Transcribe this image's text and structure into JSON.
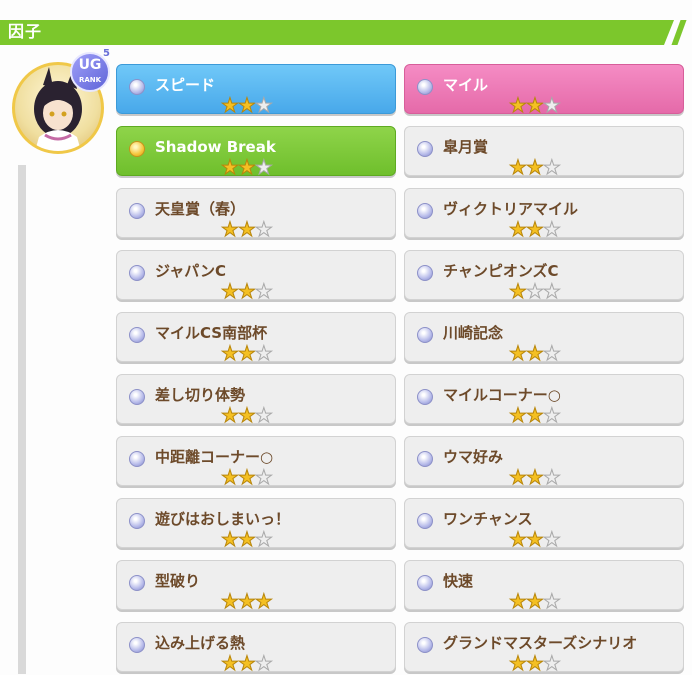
{
  "section": {
    "title": "因子"
  },
  "avatar": {
    "rank_text": "UG",
    "rank_sub": "RANK",
    "rank_level": "5"
  },
  "factors": [
    {
      "label": "スピード",
      "stars": 2,
      "style": "blue"
    },
    {
      "label": "マイル",
      "stars": 2,
      "style": "pink"
    },
    {
      "label": "Shadow Break",
      "stars": 2,
      "style": "green"
    },
    {
      "label": "皐月賞",
      "stars": 2,
      "style": "normal"
    },
    {
      "label": "天皇賞（春）",
      "stars": 2,
      "style": "normal"
    },
    {
      "label": "ヴィクトリアマイル",
      "stars": 2,
      "style": "normal"
    },
    {
      "label": "ジャパンC",
      "stars": 2,
      "style": "normal"
    },
    {
      "label": "チャンピオンズC",
      "stars": 1,
      "style": "normal"
    },
    {
      "label": "マイルCS南部杯",
      "stars": 2,
      "style": "normal"
    },
    {
      "label": "川崎記念",
      "stars": 2,
      "style": "normal"
    },
    {
      "label": "差し切り体勢",
      "stars": 2,
      "style": "normal"
    },
    {
      "label": "マイルコーナー○",
      "stars": 2,
      "style": "normal"
    },
    {
      "label": "中距離コーナー○",
      "stars": 2,
      "style": "normal"
    },
    {
      "label": "ウマ好み",
      "stars": 2,
      "style": "normal"
    },
    {
      "label": "遊びはおしまいっ！",
      "stars": 2,
      "style": "normal"
    },
    {
      "label": "ワンチャンス",
      "stars": 2,
      "style": "normal"
    },
    {
      "label": "型破り",
      "stars": 3,
      "style": "normal"
    },
    {
      "label": "快速",
      "stars": 2,
      "style": "normal"
    },
    {
      "label": "込み上げる熱",
      "stars": 2,
      "style": "normal"
    },
    {
      "label": "グランドマスターズシナリオ",
      "stars": 2,
      "style": "normal"
    }
  ],
  "max_stars": 3
}
